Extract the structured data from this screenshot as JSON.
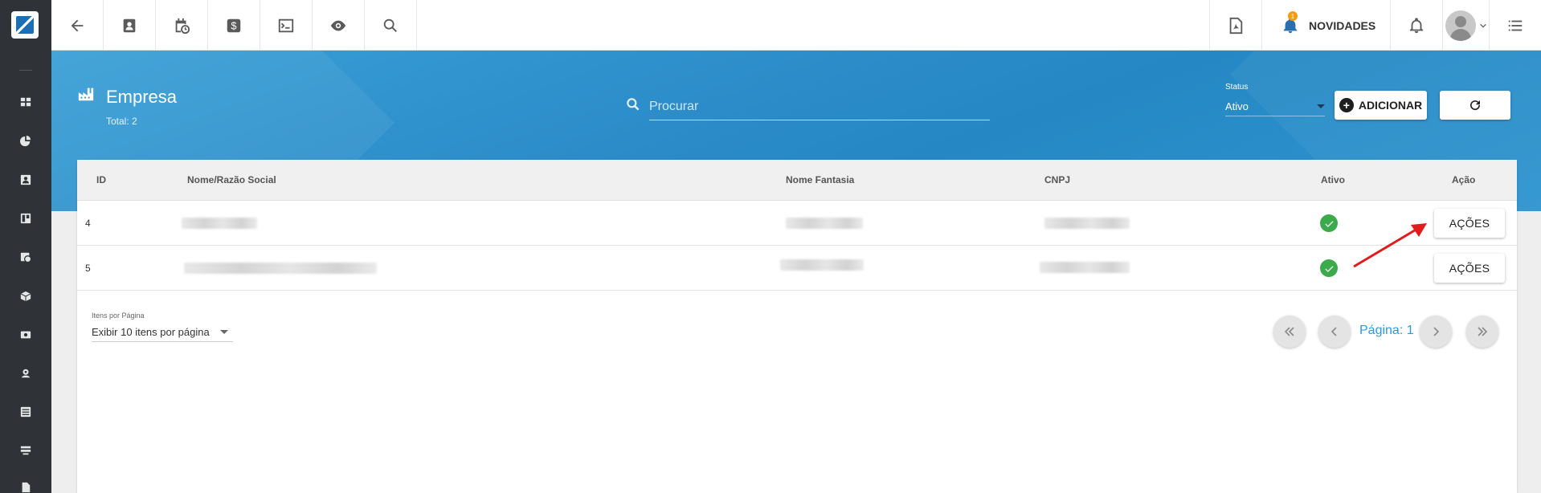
{
  "topbar": {
    "novidades_label": "NOVIDADES",
    "notification_count": "1"
  },
  "page": {
    "title": "Empresa",
    "total": "Total: 2"
  },
  "search": {
    "placeholder": "Procurar"
  },
  "status_filter": {
    "label": "Status",
    "value": "Ativo"
  },
  "buttons": {
    "add": "ADICIONAR"
  },
  "table": {
    "headers": {
      "id": "ID",
      "nome": "Nome/Razão Social",
      "fantasia": "Nome Fantasia",
      "cnpj": "CNPJ",
      "ativo": "Ativo",
      "acao": "Ação"
    },
    "rows": [
      {
        "id": "4",
        "ativo": true,
        "action_label": "AÇÕES"
      },
      {
        "id": "5",
        "ativo": true,
        "action_label": "AÇÕES"
      }
    ]
  },
  "pagination": {
    "per_page_label": "Itens por Página",
    "per_page_value": "Exibir 10 itens por página",
    "page_label": "Página: 1"
  },
  "colors": {
    "banner": "#2a8bc8",
    "sidebar": "#2f3338",
    "active_check": "#3aaa4a",
    "page_link": "#2a9be0",
    "annotation_arrow": "#e21b1b"
  }
}
